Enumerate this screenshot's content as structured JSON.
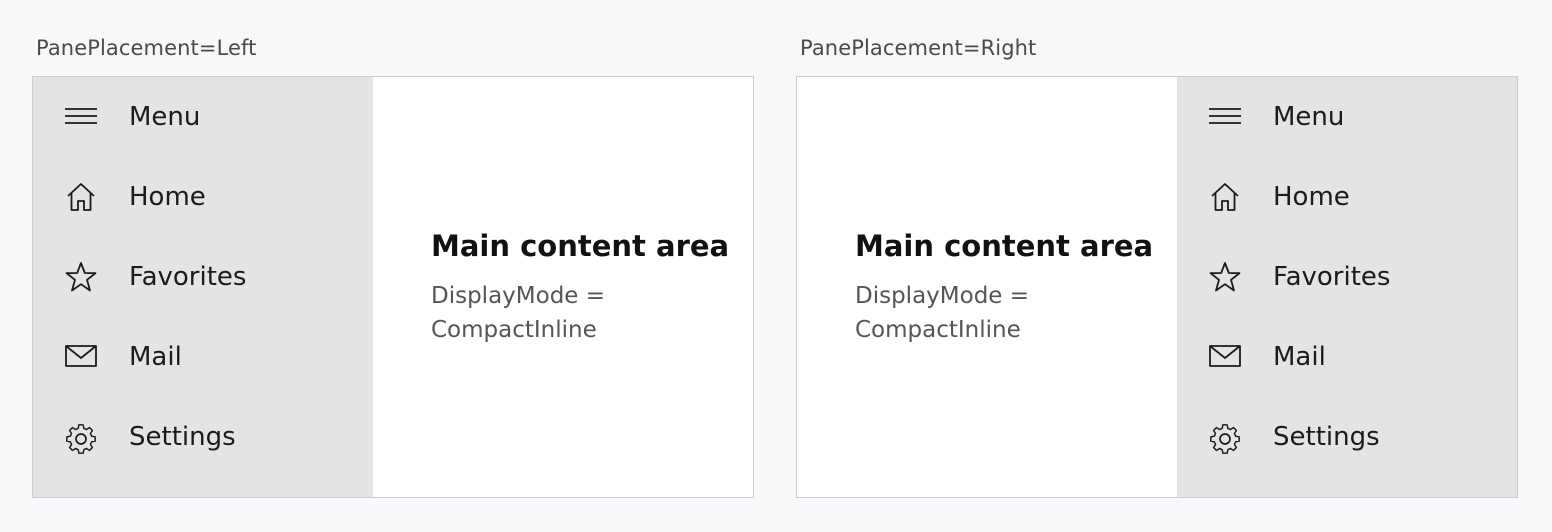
{
  "panels": [
    {
      "caption": "PanePlacement=Left",
      "menu_items": [
        {
          "label": "Menu",
          "icon": "hamburger-icon"
        },
        {
          "label": "Home",
          "icon": "home-icon"
        },
        {
          "label": "Favorites",
          "icon": "star-icon"
        },
        {
          "label": "Mail",
          "icon": "mail-icon"
        },
        {
          "label": "Settings",
          "icon": "gear-icon"
        }
      ],
      "content": {
        "title": "Main content area",
        "line1": "DisplayMode =",
        "line2": "CompactInline"
      }
    },
    {
      "caption": "PanePlacement=Right",
      "menu_items": [
        {
          "label": "Menu",
          "icon": "hamburger-icon"
        },
        {
          "label": "Home",
          "icon": "home-icon"
        },
        {
          "label": "Favorites",
          "icon": "star-icon"
        },
        {
          "label": "Mail",
          "icon": "mail-icon"
        },
        {
          "label": "Settings",
          "icon": "gear-icon"
        }
      ],
      "content": {
        "title": "Main content area",
        "line1": "DisplayMode =",
        "line2": "CompactInline"
      }
    }
  ],
  "colors": {
    "pane_background": "#e4e4e4",
    "content_background": "#ffffff",
    "page_background": "#f7f8fa",
    "frame_border": "#c8ccd1"
  }
}
